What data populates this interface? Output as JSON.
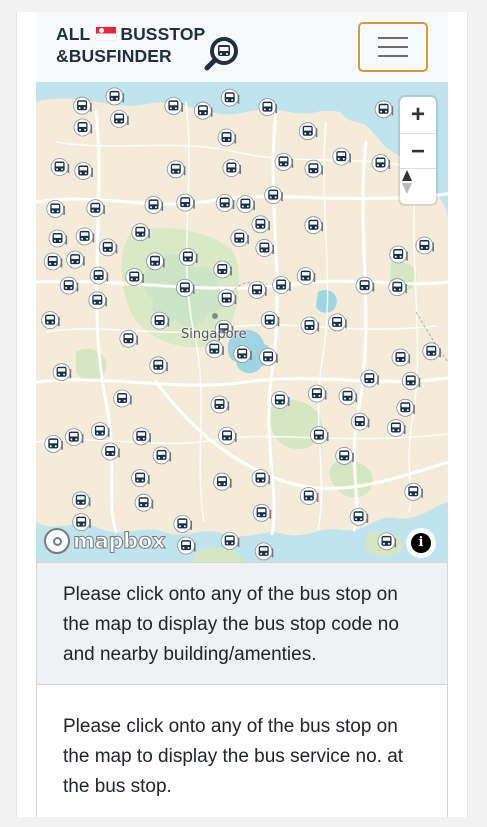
{
  "brand": {
    "line1_left": "ALL",
    "line1_right": "BUSSTOP",
    "line2": "&BUSFINDER",
    "flag_icon": "singapore-flag-icon",
    "logo_icon": "bus-search-icon"
  },
  "navbar": {
    "toggle_icon": "hamburger-menu-icon",
    "toggle_color": "#d79a3a"
  },
  "map": {
    "city_label": "Singapore",
    "zoom_in": "+",
    "zoom_out": "−",
    "compass_icon": "compass-icon",
    "attribution": "mapbox",
    "info": "i",
    "marker_icon": "bus-stop-marker-icon",
    "colors": {
      "water": "#bfe4ee",
      "land": "#f4ecd8",
      "park": "#d4e7c2",
      "road": "#ffffff"
    }
  },
  "panels": {
    "bus_stop_info": "Please click onto any of the bus stop on the map to display the bus stop code no and nearby building/amenties.",
    "bus_service_info": "Please click onto any of the bus stop on the map to display the bus service no. at the bus stop."
  }
}
